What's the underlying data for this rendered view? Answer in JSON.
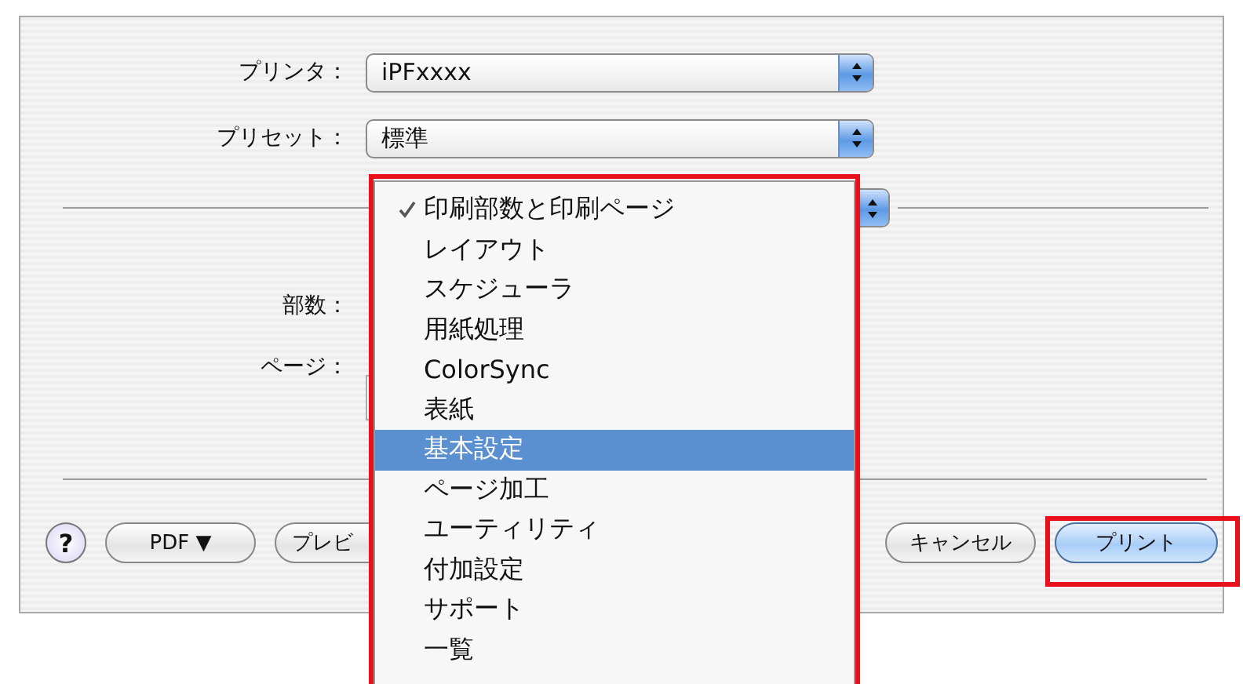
{
  "printer": {
    "label": "プリンタ：",
    "value": "iPFxxxx"
  },
  "preset": {
    "label": "プリセット：",
    "value": "標準"
  },
  "copies": {
    "label": "部数："
  },
  "pages": {
    "label": "ページ："
  },
  "buttons": [
    {
      "kind": "help",
      "label": "?"
    },
    {
      "kind": "push",
      "label": "PDF ▼"
    },
    {
      "kind": "push",
      "label": "プレビ"
    },
    {
      "kind": "push",
      "label": "キャンセル"
    },
    {
      "kind": "default",
      "label": "プリント"
    }
  ],
  "menu": {
    "items": [
      {
        "label": "印刷部数と印刷ページ",
        "checked": true,
        "selected": false
      },
      {
        "label": "レイアウト",
        "checked": false,
        "selected": false
      },
      {
        "label": "スケジューラ",
        "checked": false,
        "selected": false
      },
      {
        "label": "用紙処理",
        "checked": false,
        "selected": false
      },
      {
        "label": "ColorSync",
        "checked": false,
        "selected": false
      },
      {
        "label": "表紙",
        "checked": false,
        "selected": false
      },
      {
        "label": "基本設定",
        "checked": false,
        "selected": true
      },
      {
        "label": "ページ加工",
        "checked": false,
        "selected": false
      },
      {
        "label": "ユーティリティ",
        "checked": false,
        "selected": false
      },
      {
        "label": "付加設定",
        "checked": false,
        "selected": false
      },
      {
        "label": "サポート",
        "checked": false,
        "selected": false
      },
      {
        "label": "一覧",
        "checked": false,
        "selected": false
      }
    ]
  }
}
